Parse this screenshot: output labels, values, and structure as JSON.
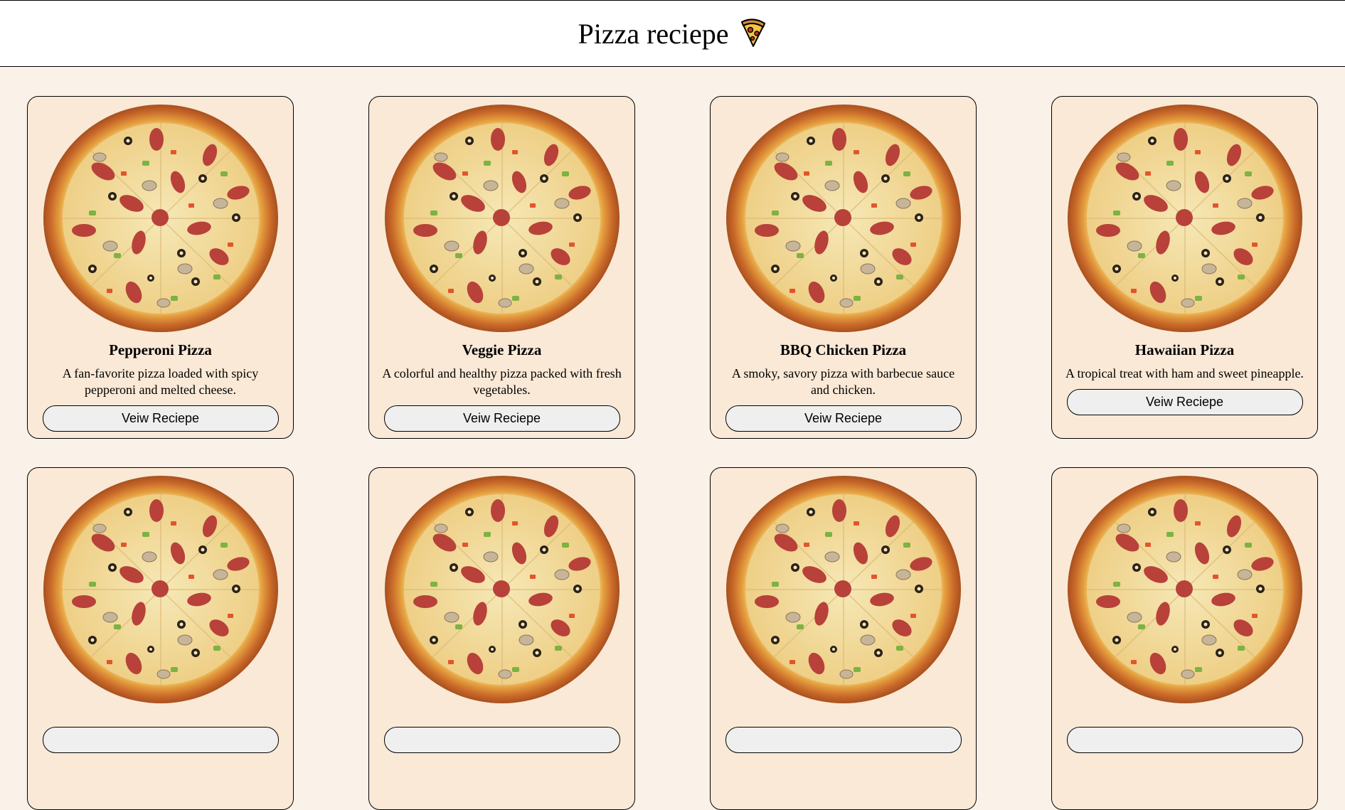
{
  "header": {
    "title": "Pizza reciepe",
    "icon": "pizza-slice-icon"
  },
  "colors": {
    "page_background": "#faf1e8",
    "card_background": "#fae9d6",
    "button_background": "#efefef"
  },
  "cards": [
    {
      "title": "Pepperoni Pizza",
      "description": "A fan-favorite pizza loaded with spicy pepperoni and melted cheese.",
      "button": "Veiw Reciepe"
    },
    {
      "title": "Veggie Pizza",
      "description": "A colorful and healthy pizza packed with fresh vegetables.",
      "button": "Veiw Reciepe"
    },
    {
      "title": "BBQ Chicken Pizza",
      "description": "A smoky, savory pizza with barbecue sauce and chicken.",
      "button": "Veiw Reciepe"
    },
    {
      "title": "Hawaiian Pizza",
      "description": "A tropical treat with ham and sweet pineapple.",
      "button": "Veiw Reciepe"
    },
    {
      "title": "",
      "description": "",
      "button": ""
    },
    {
      "title": "",
      "description": "",
      "button": ""
    },
    {
      "title": "",
      "description": "",
      "button": ""
    },
    {
      "title": "",
      "description": "",
      "button": ""
    }
  ]
}
